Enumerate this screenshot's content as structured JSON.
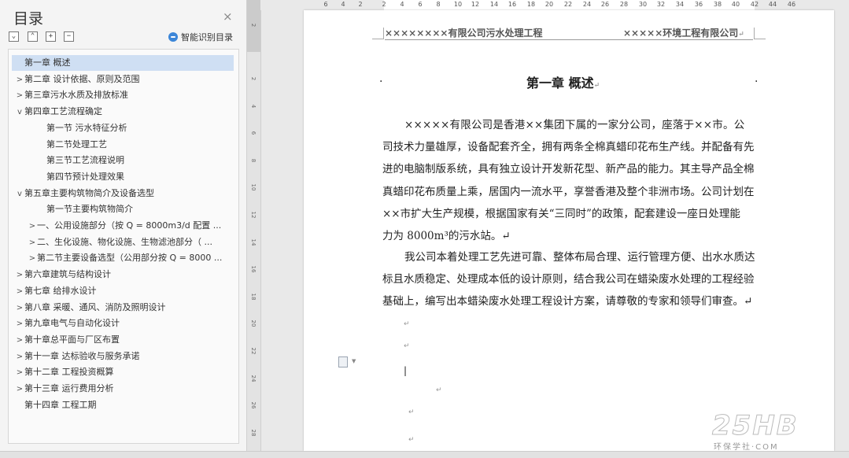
{
  "nav": {
    "title": "目录",
    "close": "×",
    "buttons": [
      "⌄",
      "⌃",
      "+",
      "−"
    ],
    "smart_toc": "智能识别目录",
    "items": [
      {
        "label": "第一章  概述",
        "arrow": "",
        "selected": true
      },
      {
        "label": "第二章  设计依据、原则及范围",
        "arrow": ">"
      },
      {
        "label": "第三章污水水质及排放标准",
        "arrow": ">"
      },
      {
        "label": "第四章工艺流程确定",
        "arrow": "v"
      },
      {
        "label": "第一节  污水特征分析",
        "arrow": ""
      },
      {
        "label": "第二节处理工艺",
        "arrow": ""
      },
      {
        "label": "第三节工艺流程说明",
        "arrow": ""
      },
      {
        "label": "第四节预计处理效果",
        "arrow": ""
      },
      {
        "label": "第五章主要构筑物简介及设备选型",
        "arrow": "v"
      },
      {
        "label": "第一节主要构筑物简介",
        "arrow": ""
      },
      {
        "label": "一、公用设施部分（按 Q = 8000m3/d 配置 ...",
        "arrow": ">"
      },
      {
        "label": "二、生化设施、物化设施、生物滤池部分（ ...",
        "arrow": ">"
      },
      {
        "label": "第二节主要设备选型（公用部分按 Q = 8000 ...",
        "arrow": ">"
      },
      {
        "label": "第六章建筑与结构设计",
        "arrow": ">"
      },
      {
        "label": "第七章    给排水设计",
        "arrow": ">"
      },
      {
        "label": "第八章    采暖、通风、消防及照明设计",
        "arrow": ">"
      },
      {
        "label": "第九章电气与自动化设计",
        "arrow": ">"
      },
      {
        "label": "第十章总平面与厂区布置",
        "arrow": ">"
      },
      {
        "label": "第十一章    达标验收与服务承诺",
        "arrow": ">"
      },
      {
        "label": "第十二章    工程投资概算",
        "arrow": ">"
      },
      {
        "label": "第十三章  运行费用分析",
        "arrow": ">"
      },
      {
        "label": "第十四章  工程工期",
        "arrow": ""
      }
    ]
  },
  "ruler": {
    "h_ticks": [
      "6",
      "4",
      "2",
      "2",
      "4",
      "6",
      "8",
      "10",
      "12",
      "14",
      "16",
      "18",
      "20",
      "22",
      "24",
      "26",
      "28",
      "30",
      "32",
      "34",
      "36",
      "38",
      "40",
      "42",
      "44",
      "46"
    ],
    "v_ticks": [
      "2",
      "2",
      "4",
      "6",
      "8",
      "10",
      "12",
      "14",
      "16",
      "18",
      "20",
      "22",
      "24",
      "26",
      "28"
    ]
  },
  "page": {
    "header_left": "××××××××有限公司污水处理工程",
    "header_right": "×××××环境工程有限公司",
    "header_mark": "↵",
    "chapter_title": "第一章    概述",
    "para_lines": [
      "×××××有限公司是香港××集团下属的一家分公司，座落于××市。公",
      "司技术力量雄厚，设备配套齐全，拥有两条全棉真蜡印花布生产线。并配备有先",
      "进的电脑制版系统，具有独立设计开发新花型、新产品的能力。其主导产品全棉",
      "真蜡印花布质量上乘，居国内一流水平，享誉香港及整个非洲市场。公司计划在",
      "××市扩大生产规模，根据国家有关“三同时”的政策，配套建设一座日处理能",
      "力为 8000m³的污水站。↵",
      "我公司本着处理工艺先进可靠、整体布局合理、运行管理方便、出水水质达",
      "标且水质稳定、处理成本低的设计原则，结合我公司在蜡染废水处理的工程经验",
      "基础上，编写出本蜡染废水处理工程设计方案，请尊敬的专家和领导们审查。↵"
    ],
    "para_mark": "↵"
  },
  "watermark": {
    "big": "25HB",
    "small": "环保学社·COM"
  }
}
